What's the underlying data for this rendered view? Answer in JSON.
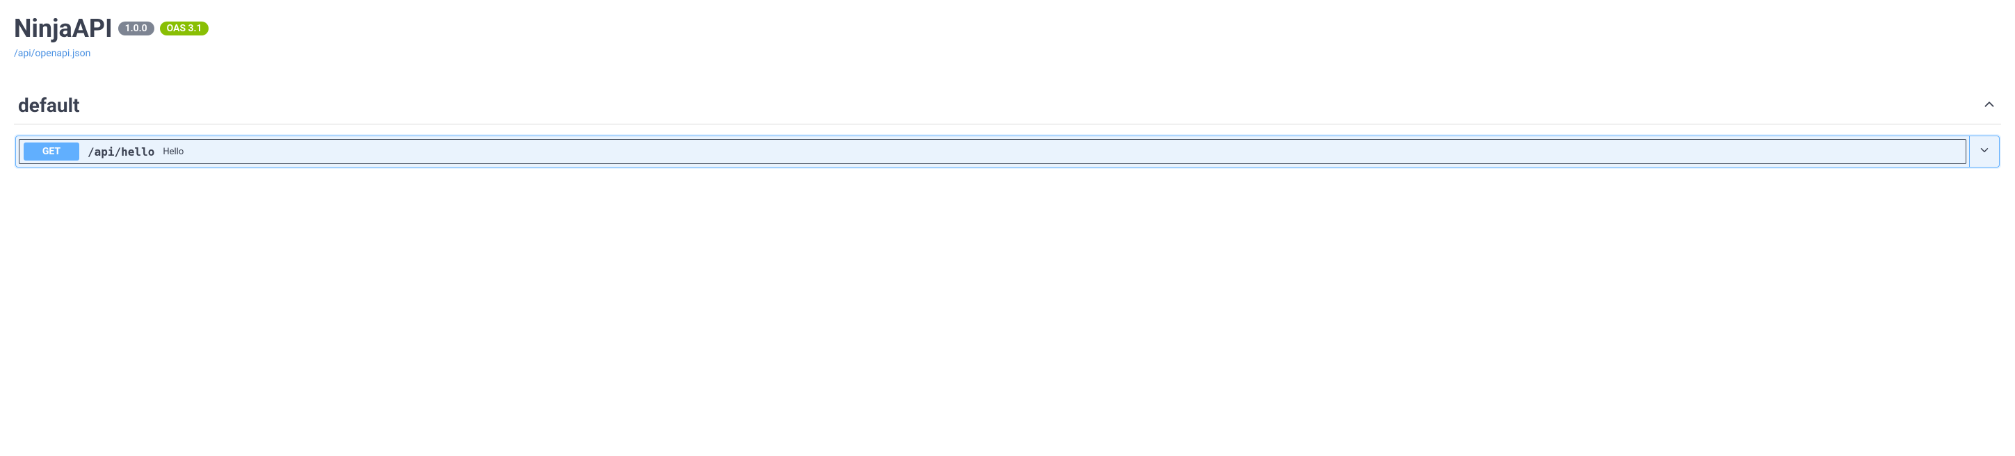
{
  "header": {
    "title": "NinjaAPI",
    "version": "1.0.0",
    "oas_version": "OAS 3.1",
    "spec_link": "/api/openapi.json"
  },
  "section": {
    "name": "default"
  },
  "operation": {
    "method": "GET",
    "path": "/api/hello",
    "summary": "Hello"
  }
}
